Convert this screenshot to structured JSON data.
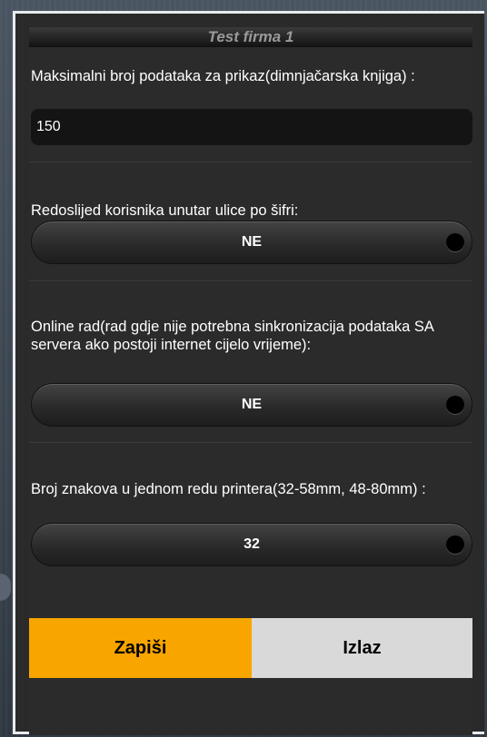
{
  "header": {
    "title": "Test firma 1"
  },
  "fields": {
    "max_records": {
      "label": "Maksimalni broj podataka za prikaz(dimnjačarska knjiga) :",
      "value": "150"
    },
    "order_by_code": {
      "label": "Redoslijed korisnika unutar ulice po šifri:",
      "value": "NE"
    },
    "online_mode": {
      "label": "Online rad(rad gdje nije potrebna sinkronizacija podataka SA servera ako postoji internet cijelo vrijeme):",
      "value": "NE"
    },
    "printer_chars": {
      "label": "Broj znakova u jednom redu printera(32-58mm, 48-80mm) :",
      "value": "32"
    }
  },
  "actions": {
    "save_label": "Zapiši",
    "exit_label": "Izlaz"
  },
  "colors": {
    "accent_save": "#f9a500",
    "exit_bg": "#d9d9d9",
    "panel_bg": "#2b2b2b"
  }
}
